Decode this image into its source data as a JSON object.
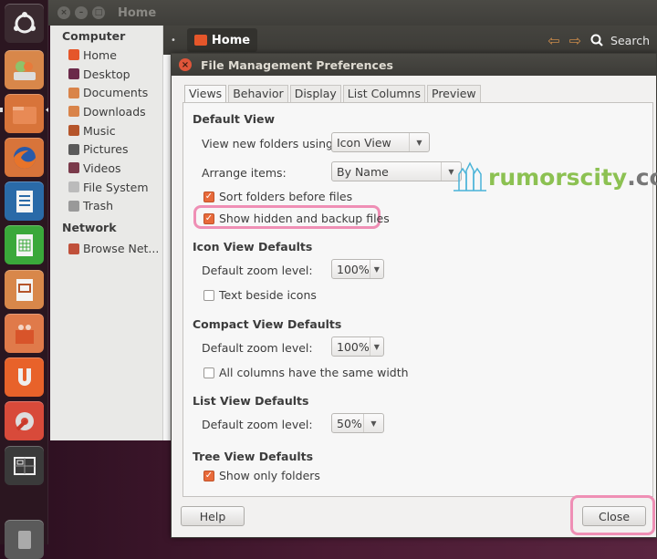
{
  "window": {
    "title": "Home"
  },
  "toolbar": {
    "breadcrumb": "Home",
    "search_label": "Search",
    "back_icon": "arrow-left-icon",
    "forward_icon": "arrow-right-icon"
  },
  "launcher": {
    "items": [
      "dash-home",
      "files-backup",
      "files-manager",
      "firefox",
      "libreoffice-writer",
      "libreoffice-calc",
      "libreoffice-impress",
      "software-center",
      "ubuntu-one",
      "system-settings",
      "workspace-switcher",
      "trash"
    ]
  },
  "places": {
    "computer_header": "Computer",
    "computer_items": [
      {
        "label": "Home",
        "color": "#e5562a"
      },
      {
        "label": "Desktop",
        "color": "#6b2a4a"
      },
      {
        "label": "Documents",
        "color": "#d9844a"
      },
      {
        "label": "Downloads",
        "color": "#d9844a"
      },
      {
        "label": "Music",
        "color": "#b5552a"
      },
      {
        "label": "Pictures",
        "color": "#5a5a5a"
      },
      {
        "label": "Videos",
        "color": "#7a3a4a"
      },
      {
        "label": "File System",
        "color": "#bbbbbb"
      },
      {
        "label": "Trash",
        "color": "#999999"
      }
    ],
    "network_header": "Network",
    "network_items": [
      {
        "label": "Browse Net...",
        "color": "#c0503a"
      }
    ]
  },
  "dialog": {
    "title": "File Management Preferences",
    "tabs": [
      "Views",
      "Behavior",
      "Display",
      "List Columns",
      "Preview"
    ],
    "active_tab": "Views",
    "default_view": {
      "header": "Default View",
      "view_new_label": "View new folders using:",
      "view_new_value": "Icon View",
      "arrange_label": "Arrange items:",
      "arrange_value": "By Name",
      "sort_folders_label": "Sort folders before files",
      "sort_folders_checked": true,
      "show_hidden_label": "Show hidden and backup files",
      "show_hidden_checked": true
    },
    "icon_view": {
      "header": "Icon View Defaults",
      "zoom_label": "Default zoom level:",
      "zoom_value": "100%",
      "text_beside_label": "Text beside icons",
      "text_beside_checked": false
    },
    "compact_view": {
      "header": "Compact View Defaults",
      "zoom_label": "Default zoom level:",
      "zoom_value": "100%",
      "same_width_label": "All columns have the same width",
      "same_width_checked": false
    },
    "list_view": {
      "header": "List View Defaults",
      "zoom_label": "Default zoom level:",
      "zoom_value": "50%"
    },
    "tree_view": {
      "header": "Tree View Defaults",
      "only_folders_label": "Show only folders",
      "only_folders_checked": true
    },
    "help_label": "Help",
    "close_label": "Close"
  },
  "watermark": {
    "part1": "rumorscity",
    "part2": ".com"
  },
  "colors": {
    "accent": "#e86a3a",
    "highlight": "#ef8fb5",
    "watermark_green": "#8cc152"
  }
}
